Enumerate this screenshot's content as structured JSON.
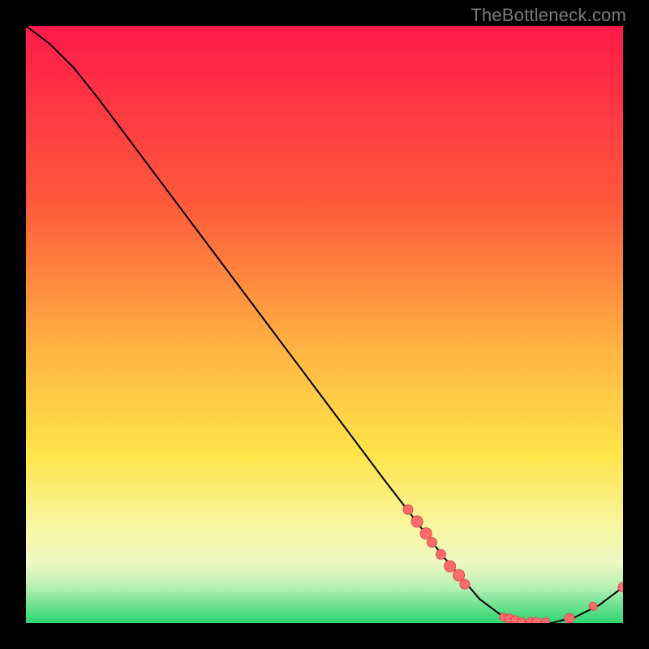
{
  "watermark": "TheBottleneck.com",
  "chart_data": {
    "type": "line",
    "title": "",
    "xlabel": "",
    "ylabel": "",
    "xlim": [
      0,
      100
    ],
    "ylim": [
      0,
      100
    ],
    "grid": false,
    "legend": false,
    "gradient_stops": [
      {
        "offset": 0,
        "color": "#ff1a4a"
      },
      {
        "offset": 30,
        "color": "#ff5a3c"
      },
      {
        "offset": 55,
        "color": "#ffb742"
      },
      {
        "offset": 72,
        "color": "#ffe54b"
      },
      {
        "offset": 84,
        "color": "#f7f6a2"
      },
      {
        "offset": 90,
        "color": "#eef8c2"
      },
      {
        "offset": 94,
        "color": "#b7f0b3"
      },
      {
        "offset": 97,
        "color": "#6fe191"
      },
      {
        "offset": 100,
        "color": "#2ed573"
      }
    ],
    "series": [
      {
        "name": "curve",
        "stroke": "#000000",
        "x": [
          0,
          4,
          8,
          12,
          18,
          30,
          45,
          60,
          70,
          76,
          80,
          84,
          88,
          92,
          96,
          100
        ],
        "y": [
          100,
          97,
          93,
          88,
          80,
          64,
          44,
          24,
          11,
          4,
          1,
          0,
          0,
          1,
          3,
          6
        ]
      }
    ],
    "markers": {
      "color": "#ff6b6b",
      "stroke": "#d94a4a",
      "radius_small": 5,
      "radius_large": 7,
      "points": [
        {
          "x": 64,
          "y": 19,
          "r": 6
        },
        {
          "x": 65.5,
          "y": 17,
          "r": 7
        },
        {
          "x": 67,
          "y": 15,
          "r": 7
        },
        {
          "x": 68,
          "y": 13.5,
          "r": 6
        },
        {
          "x": 69.5,
          "y": 11.5,
          "r": 6
        },
        {
          "x": 71,
          "y": 9.5,
          "r": 7
        },
        {
          "x": 72.5,
          "y": 8,
          "r": 7
        },
        {
          "x": 73.5,
          "y": 6.5,
          "r": 6
        },
        {
          "x": 80,
          "y": 1,
          "r": 5
        },
        {
          "x": 81,
          "y": 0.7,
          "r": 6
        },
        {
          "x": 82,
          "y": 0.4,
          "r": 6
        },
        {
          "x": 83,
          "y": 0.2,
          "r": 5
        },
        {
          "x": 84.5,
          "y": 0.1,
          "r": 6
        },
        {
          "x": 85.5,
          "y": 0.1,
          "r": 6
        },
        {
          "x": 87,
          "y": 0.2,
          "r": 5
        },
        {
          "x": 91,
          "y": 0.8,
          "r": 6
        },
        {
          "x": 95,
          "y": 2.8,
          "r": 5
        },
        {
          "x": 100,
          "y": 6,
          "r": 6
        }
      ]
    }
  }
}
